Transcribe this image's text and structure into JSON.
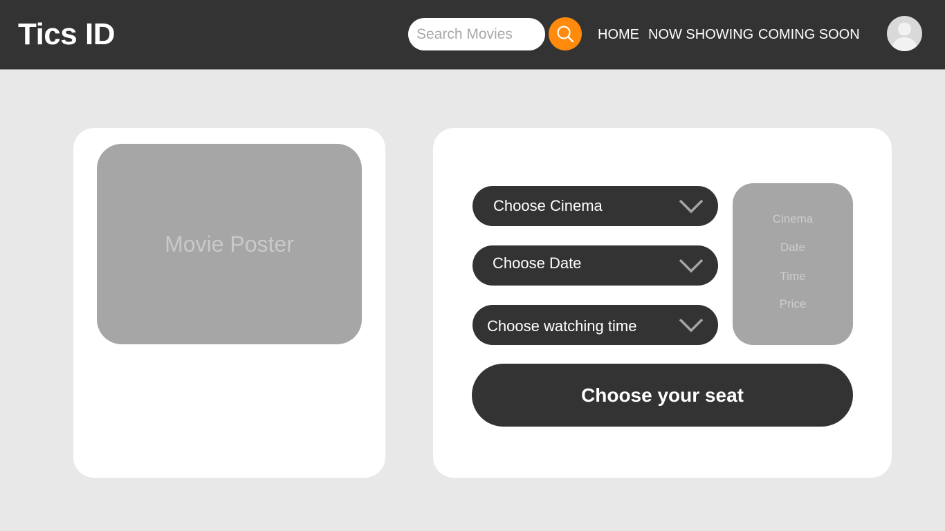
{
  "app": {
    "logo": "Tics ID"
  },
  "search": {
    "placeholder": "Search Movies",
    "button_icon": "search-icon",
    "accent_color": "#ff8a0c"
  },
  "nav": {
    "items": [
      {
        "label": "HOME"
      },
      {
        "label": "NOW SHOWING"
      },
      {
        "label": "COMING SOON"
      }
    ]
  },
  "user": {
    "avatar_icon": "user-avatar-icon"
  },
  "movie": {
    "poster_label": "Movie Poster"
  },
  "booking": {
    "dropdowns": [
      {
        "label": "Choose Cinema",
        "icon": "chevron-down-icon"
      },
      {
        "label": "Choose Date",
        "icon": "chevron-down-icon"
      },
      {
        "label": "Choose watching time",
        "icon": "chevron-down-icon"
      }
    ],
    "summary": {
      "fields": [
        "Cinema",
        "Date",
        "Time",
        "Price"
      ]
    },
    "seat_button_label": "Choose your seat"
  },
  "colors": {
    "header_bg": "#333333",
    "page_bg": "#e8e8e8",
    "card_bg": "#ffffff",
    "placeholder_gray": "#a6a6a6"
  }
}
